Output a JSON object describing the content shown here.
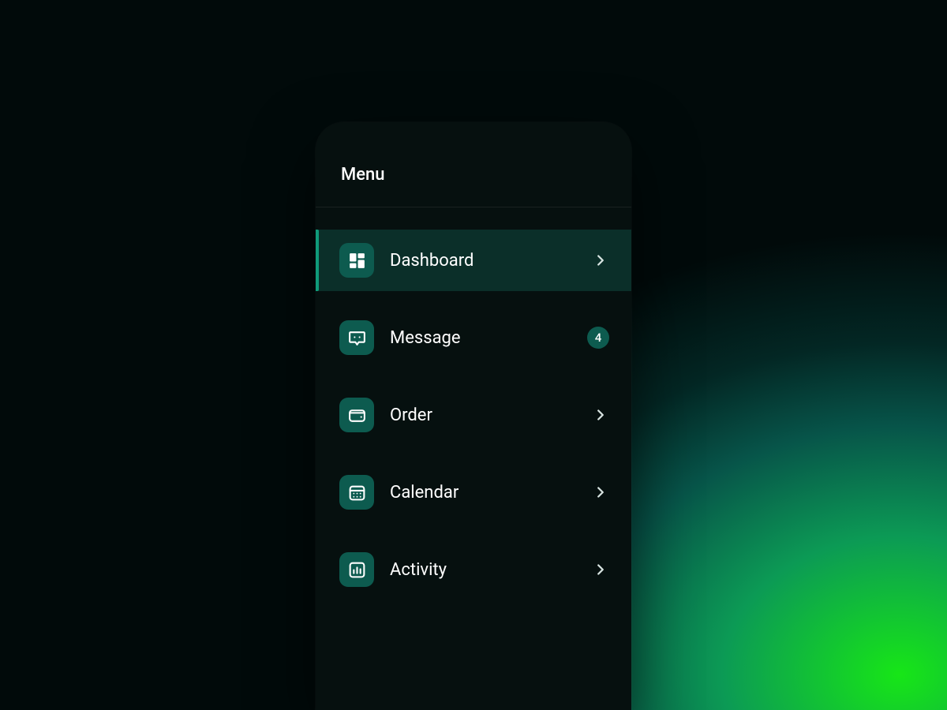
{
  "header": {
    "title": "Menu"
  },
  "menu": {
    "items": [
      {
        "label": "Dashboard",
        "icon": "dashboard-icon",
        "active": true,
        "badge": null,
        "chevron": true
      },
      {
        "label": "Message",
        "icon": "message-icon",
        "active": false,
        "badge": "4",
        "chevron": false
      },
      {
        "label": "Order",
        "icon": "wallet-icon",
        "active": false,
        "badge": null,
        "chevron": true
      },
      {
        "label": "Calendar",
        "icon": "calendar-icon",
        "active": false,
        "badge": null,
        "chevron": true
      },
      {
        "label": "Activity",
        "icon": "chart-icon",
        "active": false,
        "badge": null,
        "chevron": true
      }
    ]
  },
  "colors": {
    "accent": "#0d5b4f",
    "surface": "#06100f"
  }
}
